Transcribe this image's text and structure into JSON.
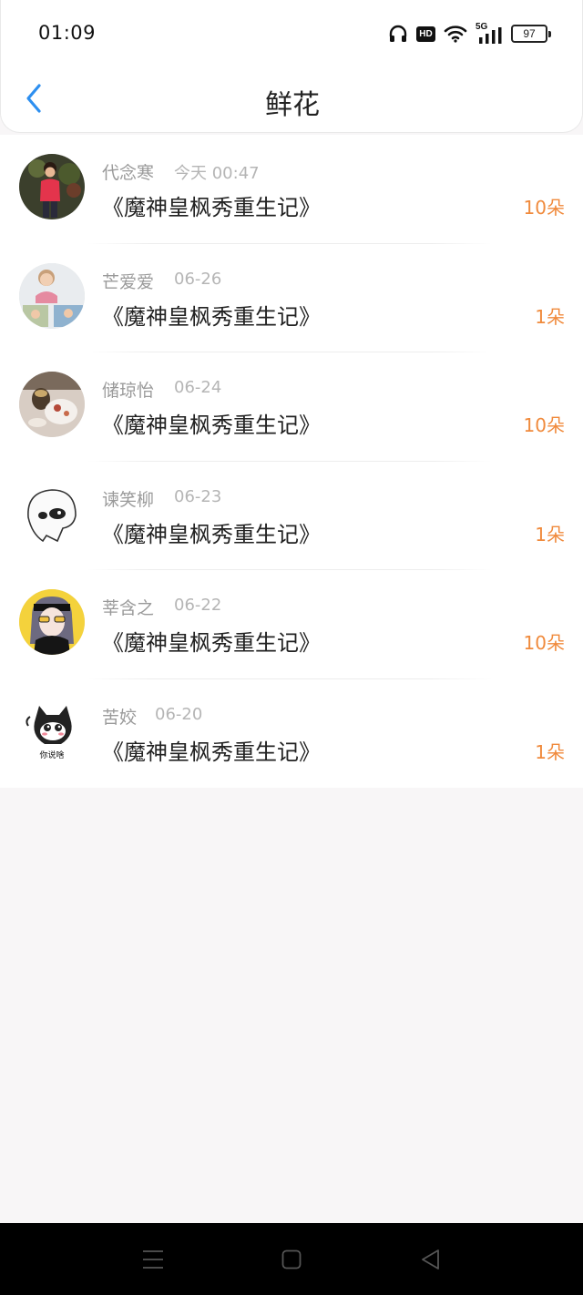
{
  "status_bar": {
    "time": "01:09",
    "icons": [
      "headphones-icon",
      "hd-icon",
      "wifi-icon",
      "5g-signal-icon"
    ],
    "signal_label": "5G",
    "hd_label": "HD",
    "battery_level": "97"
  },
  "header": {
    "title": "鲜花",
    "back_icon": "chevron-left-icon",
    "accent_color": "#2d8ff0"
  },
  "list": {
    "items": [
      {
        "name": "代念寒",
        "time": "今天 00:47",
        "book": "《魔神皇枫秀重生记》",
        "count": "10朵"
      },
      {
        "name": "芒爱爱",
        "time": "06-26",
        "book": "《魔神皇枫秀重生记》",
        "count": "1朵"
      },
      {
        "name": "储琼怡",
        "time": "06-24",
        "book": "《魔神皇枫秀重生记》",
        "count": "10朵"
      },
      {
        "name": "谏笑柳",
        "time": "06-23",
        "book": "《魔神皇枫秀重生记》",
        "count": "1朵"
      },
      {
        "name": "莘含之",
        "time": "06-22",
        "book": "《魔神皇枫秀重生记》",
        "count": "10朵"
      },
      {
        "name": "苦姣",
        "time": "06-20",
        "book": "《魔神皇枫秀重生记》",
        "count": "1朵"
      }
    ],
    "count_color": "#f08a3c",
    "avatar_6_caption": "你说啥"
  },
  "nav_bar": {
    "buttons": [
      "menu-icon",
      "home-square-icon",
      "back-triangle-icon"
    ]
  }
}
